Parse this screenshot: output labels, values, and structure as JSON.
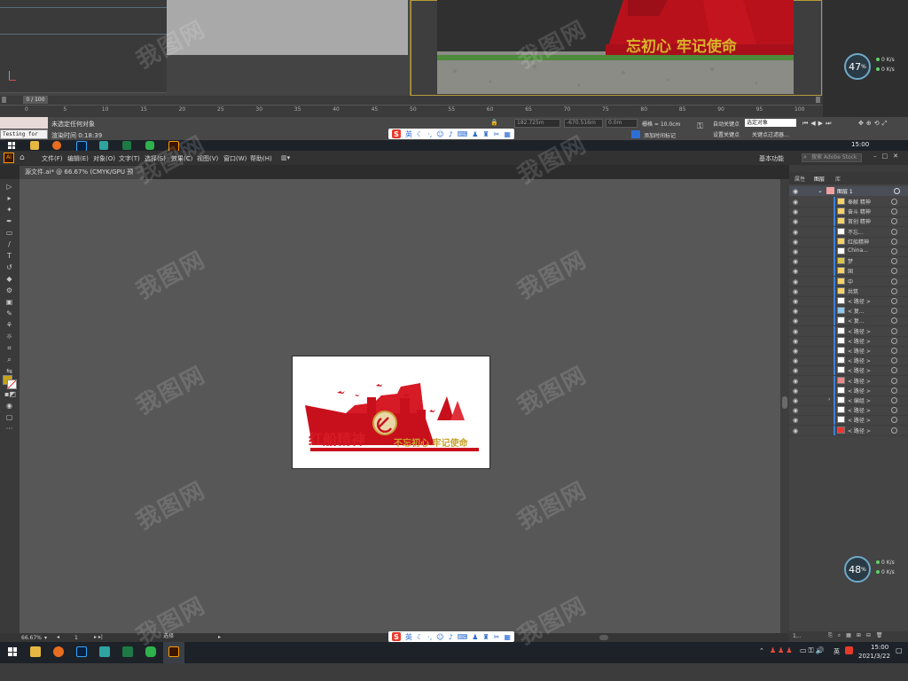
{
  "max": {
    "frame_counter": "0 / 100",
    "timeline_ticks": [
      "0",
      "5",
      "10",
      "15",
      "20",
      "25",
      "30",
      "35",
      "40",
      "45",
      "50",
      "55",
      "60",
      "65",
      "70",
      "75",
      "80",
      "85",
      "90",
      "95",
      "100"
    ],
    "testing_label": "Testing for All",
    "status_line1": "未选定任何对象",
    "status_line2": "渲染时间 0:18:39",
    "coord_x": "182.725m",
    "coord_y": "-670.516m",
    "coord_z": "0.0m",
    "grid": "栅格 = 10.0cm",
    "auto_key": "自动关键点",
    "set_key": "设置关键点",
    "selection_set": "选定对象",
    "key_filter": "关键点过滤器...",
    "add_time_tag": "添加时间标记",
    "render_text": "忘初心 牢记使命",
    "gauge_top": {
      "value": "47",
      "unit": "%",
      "rate_up": "0 K/s",
      "rate_down": "0 K/s"
    },
    "gauge_bottom": {
      "value": "48",
      "unit": "%",
      "rate_up": "0 K/s",
      "rate_down": "0 K/s"
    }
  },
  "taskbar_top": {
    "time": "15:00",
    "ime": "英"
  },
  "taskbar_bottom": {
    "time": "15:00",
    "date": "2021/3/22",
    "ime": "英",
    "hover_label": "选择"
  },
  "sogou": {
    "lang": "英"
  },
  "ai": {
    "app_badge": "Ai",
    "menu": [
      "文件(F)",
      "编辑(E)",
      "对象(O)",
      "文字(T)",
      "选择(S)",
      "效果(C)",
      "视图(V)",
      "窗口(W)",
      "帮助(H)"
    ],
    "workspace": "基本功能",
    "search_placeholder": "搜索 Adobe Stock",
    "doc_tab": "源文件.ai* @ 66.67% (CMYK/GPU 预览)",
    "zoom": "66.67%",
    "artboard_num": "1",
    "panel_tabs": [
      "属性",
      "图层",
      "库"
    ],
    "layer_name": "图层 1",
    "layers": [
      "奉献 精神",
      "奋斗 精神",
      "首创 精神",
      "不忘...",
      "红船精神",
      "China...",
      "梦",
      "国",
      "中",
      "共筑",
      "< 路径 >",
      "< 复...",
      "< 复...",
      "< 路径 >",
      "< 路径 >",
      "< 路径 >",
      "< 路径 >",
      "< 路径 >",
      "< 路径 >",
      "< 路径 >",
      "< 编组 >",
      "< 路径 >",
      "< 路径 >",
      "< 路径 >"
    ],
    "panel_footer": "1..."
  },
  "artwork": {
    "title_left": "红船精神",
    "title_right": "不忘初心 牢记使命"
  },
  "watermark": "我图网"
}
